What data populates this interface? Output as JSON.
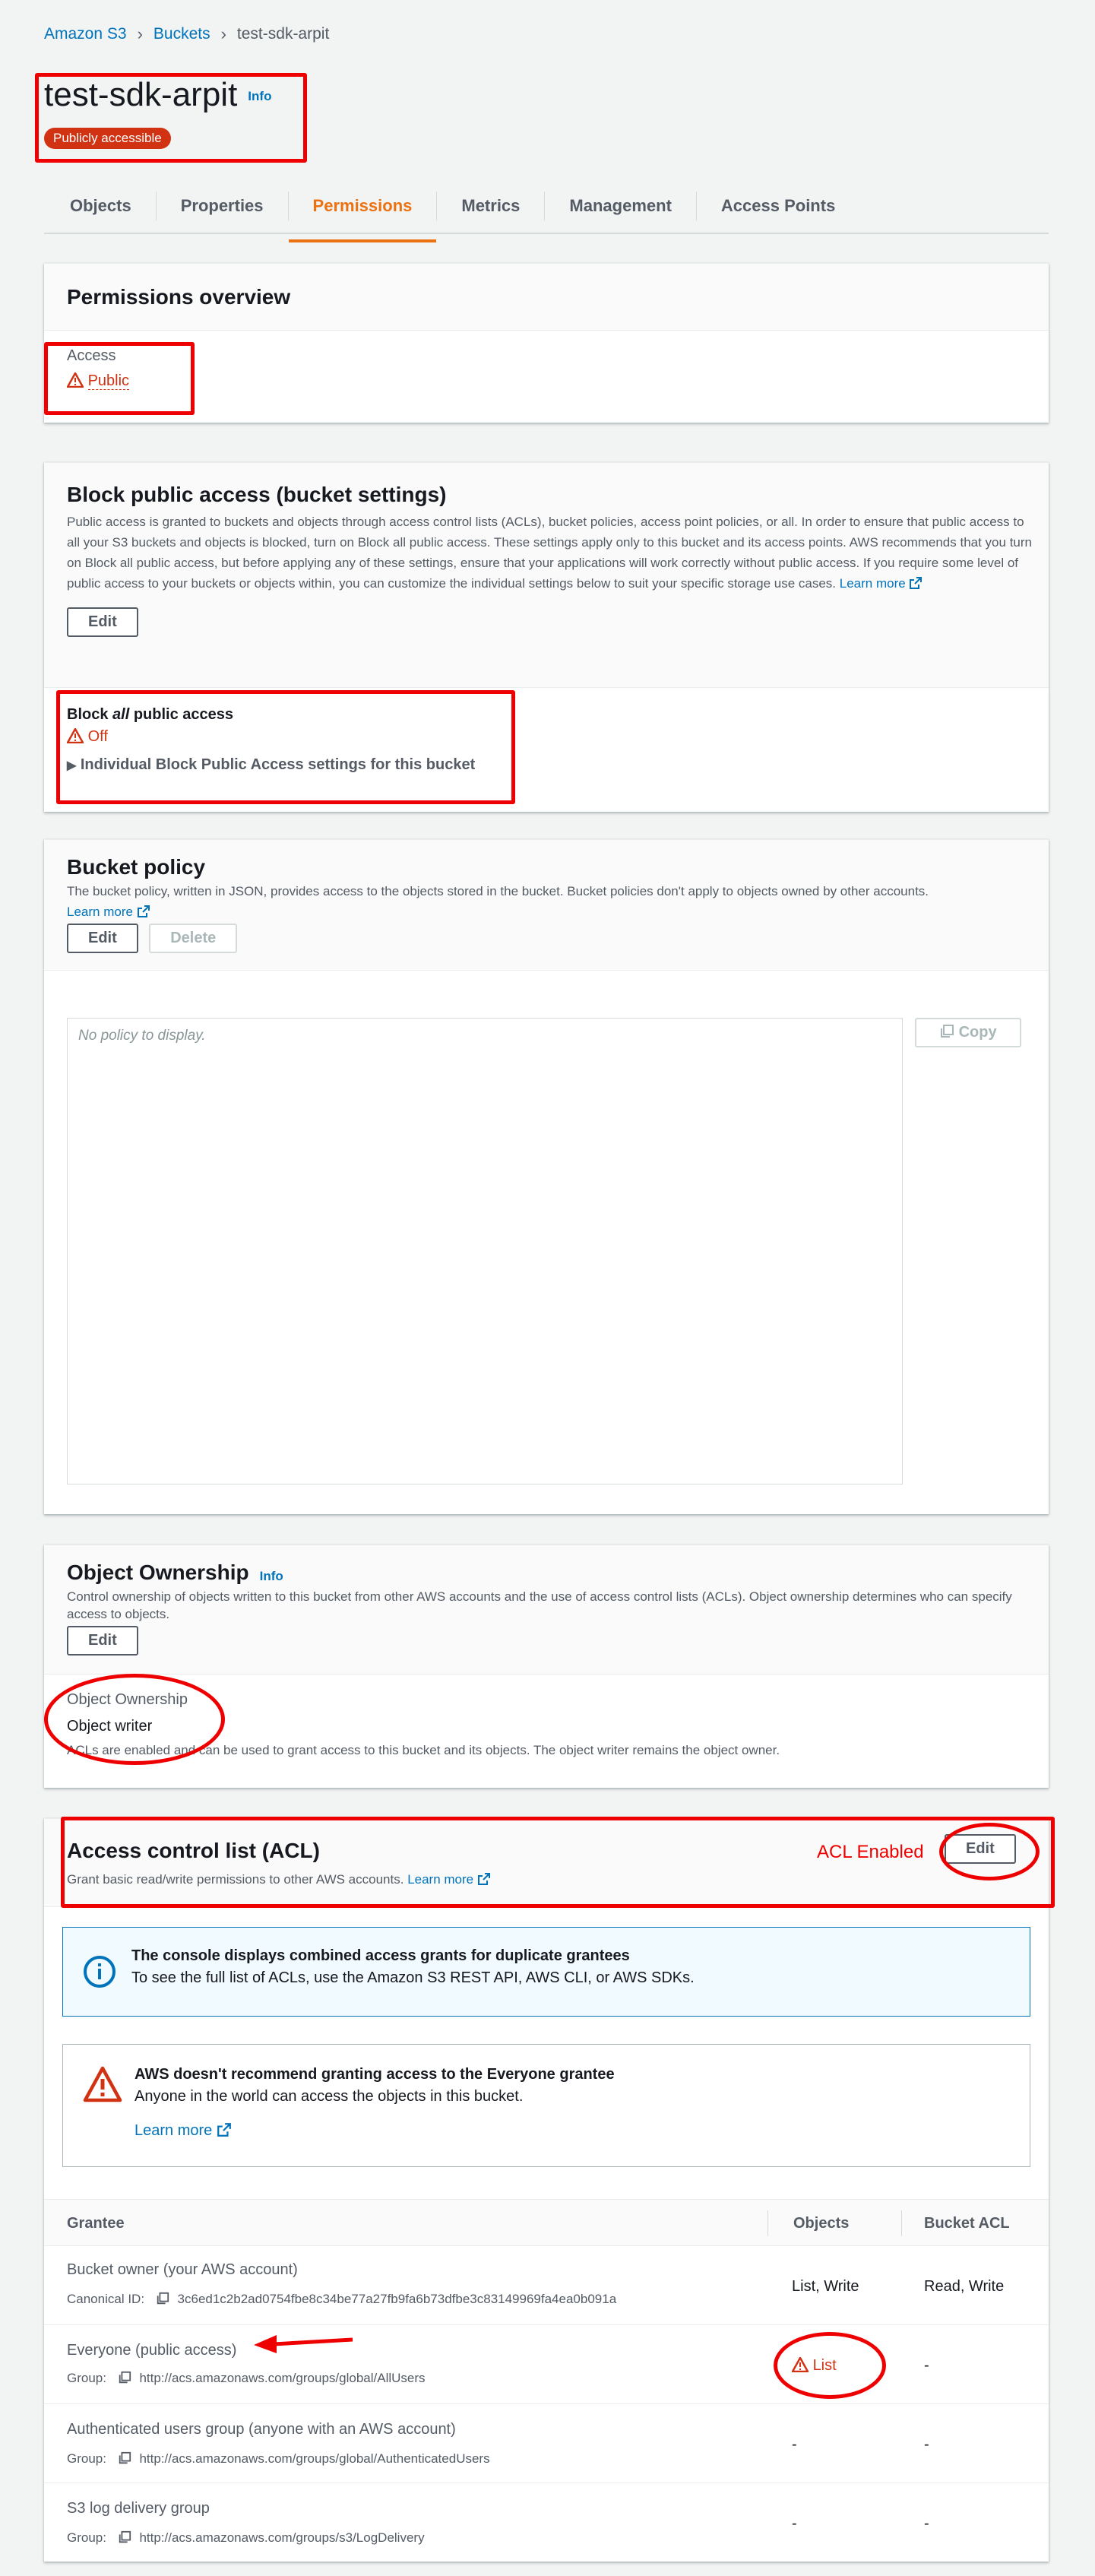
{
  "breadcrumb": {
    "items": [
      "Amazon S3",
      "Buckets",
      "test-sdk-arpit"
    ]
  },
  "bucket": {
    "name": "test-sdk-arpit",
    "info_link": "Info",
    "badge": "Publicly accessible"
  },
  "tabs": [
    "Objects",
    "Properties",
    "Permissions",
    "Metrics",
    "Management",
    "Access Points"
  ],
  "active_tab": "Permissions",
  "overview": {
    "title": "Permissions overview",
    "access_label": "Access",
    "access_value": "Public"
  },
  "block_public": {
    "title": "Block public access (bucket settings)",
    "description": "Public access is granted to buckets and objects through access control lists (ACLs), bucket policies, access point policies, or all. In order to ensure that public access to all your S3 buckets and objects is blocked, turn on Block all public access. These settings apply only to this bucket and its access points. AWS recommends that you turn on Block all public access, but before applying any of these settings, ensure that your applications will work correctly without public access. If you require some level of public access to your buckets or objects within, you can customize the individual settings below to suit your specific storage use cases.",
    "learn_more": "Learn more",
    "edit": "Edit",
    "block_all_prefix": "Block ",
    "block_all_em": "all",
    "block_all_suffix": " public access",
    "status": "Off",
    "individual": "Individual Block Public Access settings for this bucket"
  },
  "bucket_policy": {
    "title": "Bucket policy",
    "description": "The bucket policy, written in JSON, provides access to the objects stored in the bucket. Bucket policies don't apply to objects owned by other accounts.",
    "learn_more": "Learn more",
    "edit": "Edit",
    "delete": "Delete",
    "placeholder": "No policy to display.",
    "copy": "Copy"
  },
  "ownership": {
    "title": "Object Ownership",
    "info": "Info",
    "description": "Control ownership of objects written to this bucket from other AWS accounts and the use of access control lists (ACLs). Object ownership determines who can specify access to objects.",
    "edit": "Edit",
    "label": "Object Ownership",
    "value": "Object writer",
    "note": "ACLs are enabled and can be used to grant access to this bucket and its objects. The object writer remains the object owner."
  },
  "acl": {
    "title": "Access control list (ACL)",
    "description": "Grant basic read/write permissions to other AWS accounts.",
    "learn_more": "Learn more",
    "annotation": "ACL Enabled",
    "edit": "Edit",
    "info_title": "The console displays combined access grants for duplicate grantees",
    "info_body": "To see the full list of ACLs, use the Amazon S3 REST API, AWS CLI, or AWS SDKs.",
    "warn_title": "AWS doesn't recommend granting access to the Everyone grantee",
    "warn_body": "Anyone in the world can access the objects in this bucket.",
    "warn_link": "Learn more",
    "columns": [
      "Grantee",
      "Objects",
      "Bucket ACL"
    ],
    "rows": [
      {
        "name": "Bucket owner (your AWS account)",
        "sub_label": "Canonical ID:",
        "sub_value": "3c6ed1c2b2ad0754fbe8c34be77a27fb9fa6b73dfbe3c83149969fa4ea0b091a",
        "objects": "List, Write",
        "bucket_acl": "Read, Write"
      },
      {
        "name": "Everyone (public access)",
        "sub_label": "Group:",
        "sub_value": "http://acs.amazonaws.com/groups/global/AllUsers",
        "objects": "List",
        "bucket_acl": "-"
      },
      {
        "name": "Authenticated users group (anyone with an AWS account)",
        "sub_label": "Group:",
        "sub_value": "http://acs.amazonaws.com/groups/global/AuthenticatedUsers",
        "objects": "-",
        "bucket_acl": "-"
      },
      {
        "name": "S3 log delivery group",
        "sub_label": "Group:",
        "sub_value": "http://acs.amazonaws.com/groups/s3/LogDelivery",
        "objects": "-",
        "bucket_acl": "-"
      }
    ]
  },
  "colors": {
    "link": "#0073bb",
    "active_tab": "#ec7211",
    "danger": "#d13212",
    "annotation": "#e00000"
  }
}
